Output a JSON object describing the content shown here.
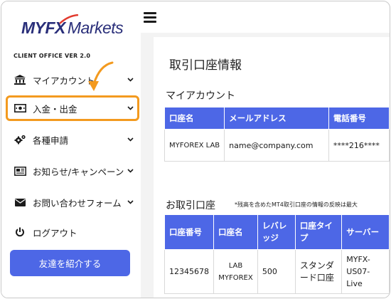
{
  "brand": {
    "logo_myfx": "MYFX",
    "logo_markets": "Markets",
    "version": "CLIENT OFFICE VER 2.0"
  },
  "colors": {
    "accent": "#4d67e6",
    "highlight": "#f39a1f",
    "logo": "#2a2f7a"
  },
  "sidebar": {
    "items": [
      {
        "label": "マイアカウント",
        "icon": "bank-icon",
        "has_chevron": true
      },
      {
        "label": "入金・出金",
        "icon": "cash-icon",
        "has_chevron": true,
        "highlighted": true
      },
      {
        "label": "各種申請",
        "icon": "gears-icon",
        "has_chevron": true
      },
      {
        "label": "お知らせ/キャンペーン",
        "icon": "newspaper-icon",
        "has_chevron": true
      },
      {
        "label": "お問い合わせフォーム",
        "icon": "envelope-icon",
        "has_chevron": true
      },
      {
        "label": "ログアウト",
        "icon": "power-icon",
        "has_chevron": false
      }
    ],
    "refer_button": "友達を紹介する"
  },
  "main": {
    "page_title": "取引口座情報",
    "my_account": {
      "title": "マイアカウント",
      "columns": [
        "口座名",
        "メールアドレス",
        "電話番号"
      ],
      "rows": [
        [
          "MYFOREX LAB",
          "name@company.com",
          "****216****"
        ]
      ]
    },
    "trading_accounts": {
      "title": "お取引口座",
      "notice": "*残高を含めたMT4取引口座の情報の反映は最大",
      "columns": [
        "口座番号",
        "口座名",
        "レバレッジ",
        "口座タイプ",
        "サーバー"
      ],
      "rows": [
        [
          "12345678",
          "LAB MYFOREX",
          "500",
          "スタンダード口座",
          "MYFX-US07-Live"
        ]
      ]
    }
  }
}
